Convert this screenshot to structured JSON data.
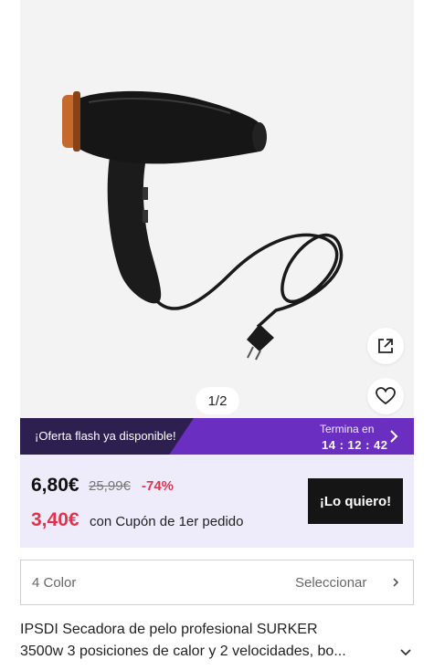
{
  "gallery": {
    "pager": "1/2",
    "share_icon": "external-share-icon",
    "favorite_icon": "heart-icon"
  },
  "flash": {
    "label": "¡Oferta flash ya disponible!",
    "ends_label": "Termina en",
    "countdown": "14 : 12 : 42",
    "arrow_icon": "chevron-right-icon"
  },
  "pricing": {
    "price": "6,80€",
    "old_price": "25,99€",
    "discount": "-74%",
    "coupon_price": "3,40€",
    "coupon_text": "con Cupón de 1er pedido",
    "buy_label": "¡Lo quiero!"
  },
  "variant": {
    "label": "4 Color",
    "select_label": "Seleccionar",
    "chevron_icon": "chevron-right-icon"
  },
  "product": {
    "title_line1": "IPSDI Secadora de pelo profesional SURKER",
    "title_line2": "3500w 3 posiciones de calor y 2 velocidades, bo...",
    "expand_icon": "chevron-down-icon"
  },
  "colors": {
    "flash_purple": "#6a2fc0",
    "flash_dark": "#2d2050",
    "price_box_bg": "#eeecfb",
    "discount_red": "#e0344d",
    "button_black": "#151515"
  }
}
